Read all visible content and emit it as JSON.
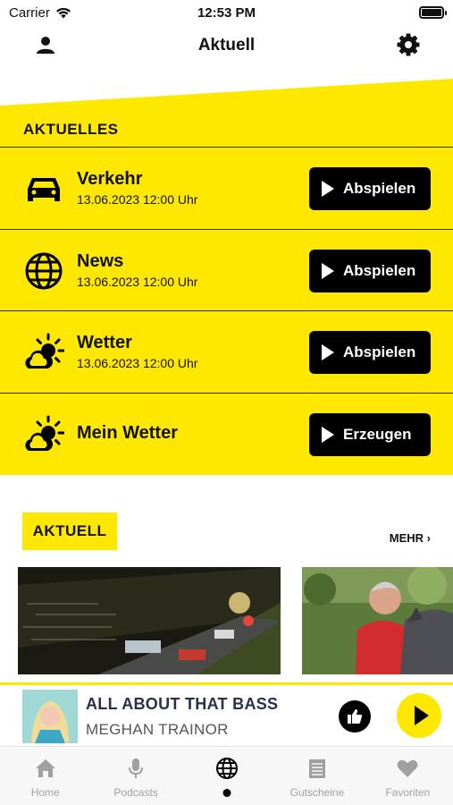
{
  "status_bar": {
    "carrier": "Carrier",
    "time": "12:53 PM"
  },
  "nav": {
    "title": "Aktuell",
    "profile_icon": "person-icon",
    "settings_icon": "gear-icon"
  },
  "aktuelles": {
    "heading": "AKTUELLES",
    "items": [
      {
        "title": "Verkehr",
        "date": "13.06.2023 12:00 Uhr",
        "button": "Abspielen",
        "icon": "car-icon"
      },
      {
        "title": "News",
        "date": "13.06.2023 12:00 Uhr",
        "button": "Abspielen",
        "icon": "globe-icon"
      },
      {
        "title": "Wetter",
        "date": "13.06.2023 12:00 Uhr",
        "button": "Abspielen",
        "icon": "weather-icon"
      },
      {
        "title": "Mein Wetter",
        "date": "",
        "button": "Erzeugen",
        "icon": "weather-icon"
      }
    ]
  },
  "news_section": {
    "badge": "AKTUELL",
    "more_label": "MEHR ›"
  },
  "player": {
    "title": "ALL ABOUT THAT BASS",
    "artist": "MEGHAN TRAINOR",
    "like_icon": "thumbs-up-icon",
    "play_icon": "play-icon"
  },
  "tabbar": {
    "tabs": [
      {
        "label": "Home",
        "icon": "home-icon"
      },
      {
        "label": "Podcasts",
        "icon": "microphone-icon"
      },
      {
        "label": "",
        "icon": "globe-icon"
      },
      {
        "label": "Gutscheine",
        "icon": "voucher-icon"
      },
      {
        "label": "Favoriten",
        "icon": "heart-icon"
      }
    ]
  },
  "colors": {
    "accent_yellow": "#ffe800",
    "black": "#000000",
    "tab_inactive": "#a0a0a0"
  }
}
